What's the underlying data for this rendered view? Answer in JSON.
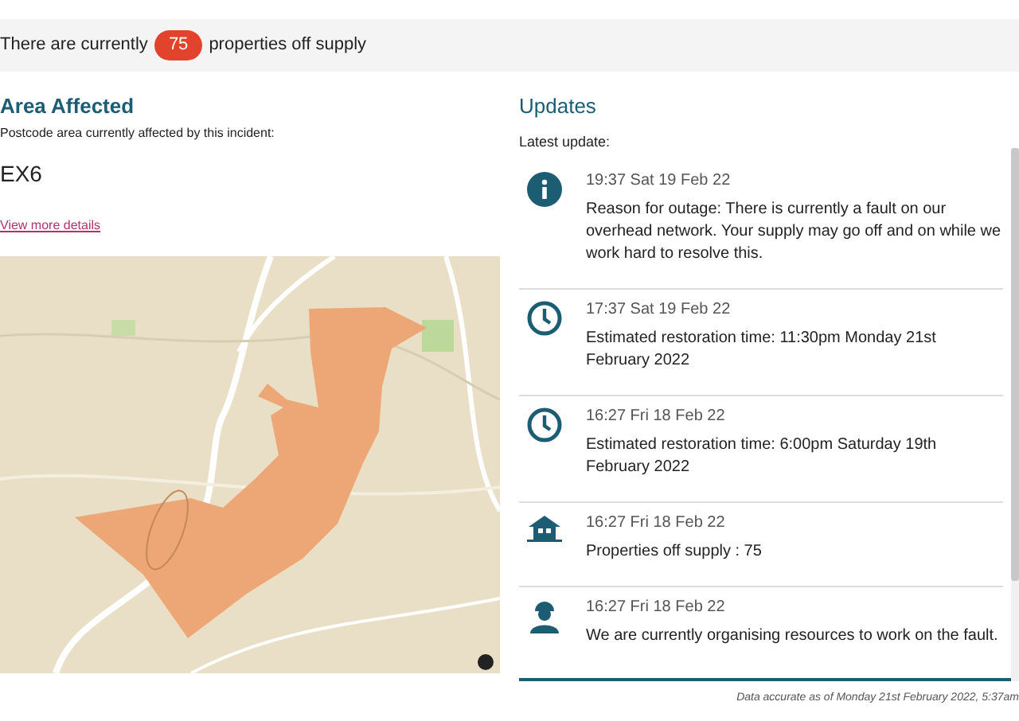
{
  "banner": {
    "before": "There are currently",
    "count": "75",
    "after": "properties off supply"
  },
  "area": {
    "title": "Area Affected",
    "subtitle": "Postcode area currently affected by this incident:",
    "postcode": "EX6",
    "link": "View more details"
  },
  "updates": {
    "title": "Updates",
    "latest_label": "Latest update:",
    "items": [
      {
        "kind": "info",
        "time": "19:37 Sat 19 Feb 22",
        "text": "Reason for outage: There is currently a fault on our overhead network. Your supply may go off and on while we work hard to resolve this."
      },
      {
        "kind": "clock",
        "time": "17:37 Sat 19 Feb 22",
        "text": "Estimated restoration time: 11:30pm Monday 21st February 2022"
      },
      {
        "kind": "clock",
        "time": "16:27 Fri 18 Feb 22",
        "text": "Estimated restoration time: 6:00pm Saturday 19th February 2022"
      },
      {
        "kind": "house",
        "time": "16:27 Fri 18 Feb 22",
        "text": "Properties off supply : 75"
      },
      {
        "kind": "worker",
        "time": "16:27 Fri 18 Feb 22",
        "text": "We are currently organising resources to work on the fault."
      }
    ]
  },
  "footer": "Data accurate as of Monday 21st February 2022, 5:37am"
}
